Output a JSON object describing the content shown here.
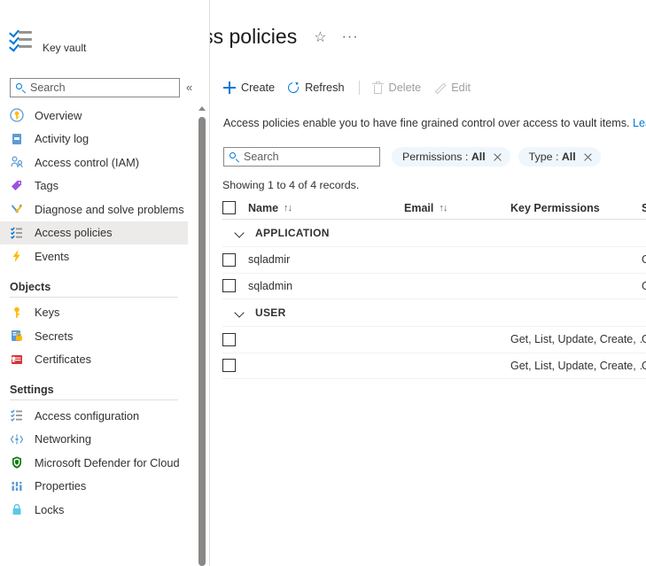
{
  "sidebar": {
    "resource_type": "Key vault",
    "search": {
      "placeholder": "Search"
    },
    "collapse_label": "«",
    "items": [
      {
        "label": "Overview",
        "icon": "key-circle-icon",
        "selected": false
      },
      {
        "label": "Activity log",
        "icon": "activity-log-icon",
        "selected": false
      },
      {
        "label": "Access control (IAM)",
        "icon": "access-control-icon",
        "selected": false
      },
      {
        "label": "Tags",
        "icon": "tag-icon",
        "selected": false
      },
      {
        "label": "Diagnose and solve problems",
        "icon": "wrench-icon",
        "selected": false
      },
      {
        "label": "Access policies",
        "icon": "checklist-icon",
        "selected": true
      },
      {
        "label": "Events",
        "icon": "lightning-icon",
        "selected": false
      }
    ],
    "objects_section": {
      "title": "Objects",
      "items": [
        {
          "label": "Keys",
          "icon": "key-icon"
        },
        {
          "label": "Secrets",
          "icon": "secret-lock-icon"
        },
        {
          "label": "Certificates",
          "icon": "certificate-icon"
        }
      ]
    },
    "settings_section": {
      "title": "Settings",
      "items": [
        {
          "label": "Access configuration",
          "icon": "checklist-icon"
        },
        {
          "label": "Networking",
          "icon": "networking-icon"
        },
        {
          "label": "Microsoft Defender for Cloud",
          "icon": "shield-icon"
        },
        {
          "label": "Properties",
          "icon": "properties-icon"
        },
        {
          "label": "Locks",
          "icon": "lock-icon"
        }
      ]
    }
  },
  "header": {
    "title_prefix": "|",
    "title": "Access policies",
    "favorite_icon": "star-icon",
    "more_icon": "ellipsis-icon"
  },
  "toolbar": {
    "create_label": "Create",
    "refresh_label": "Refresh",
    "delete_label": "Delete",
    "edit_label": "Edit"
  },
  "info": {
    "text": "Access policies enable you to have fine grained control over access to vault items.",
    "link_label": "Learn more"
  },
  "filters": {
    "search": {
      "placeholder": "Search"
    },
    "pills": [
      {
        "name": "Permissions",
        "value": "All"
      },
      {
        "name": "Type",
        "value": "All"
      }
    ]
  },
  "table": {
    "records_text": "Showing 1 to 4 of 4 records.",
    "columns": [
      {
        "label": "Name",
        "sortable": true
      },
      {
        "label": "Email",
        "sortable": true
      },
      {
        "label": "Key Permissions",
        "sortable": false
      },
      {
        "label": "S",
        "sortable": false
      }
    ],
    "groups": [
      {
        "label": "APPLICATION",
        "rows": [
          {
            "name": "sqladmir",
            "email": "",
            "key_permissions": "",
            "secret_permissions": "G"
          },
          {
            "name": "sqladmin",
            "email": "",
            "key_permissions": "",
            "secret_permissions": "G"
          }
        ]
      },
      {
        "label": "USER",
        "rows": [
          {
            "name": "",
            "email": "",
            "key_permissions": "Get, List, Update, Create, …",
            "secret_permissions": "G"
          },
          {
            "name": "",
            "email": "",
            "key_permissions": "Get, List, Update, Create, …",
            "secret_permissions": "G"
          }
        ]
      }
    ]
  },
  "colors": {
    "accent": "#0078d4",
    "selected_bg": "#edebe9",
    "pill_bg": "#eff6fc",
    "text": "#323130",
    "disabled": "#a19f9d"
  }
}
